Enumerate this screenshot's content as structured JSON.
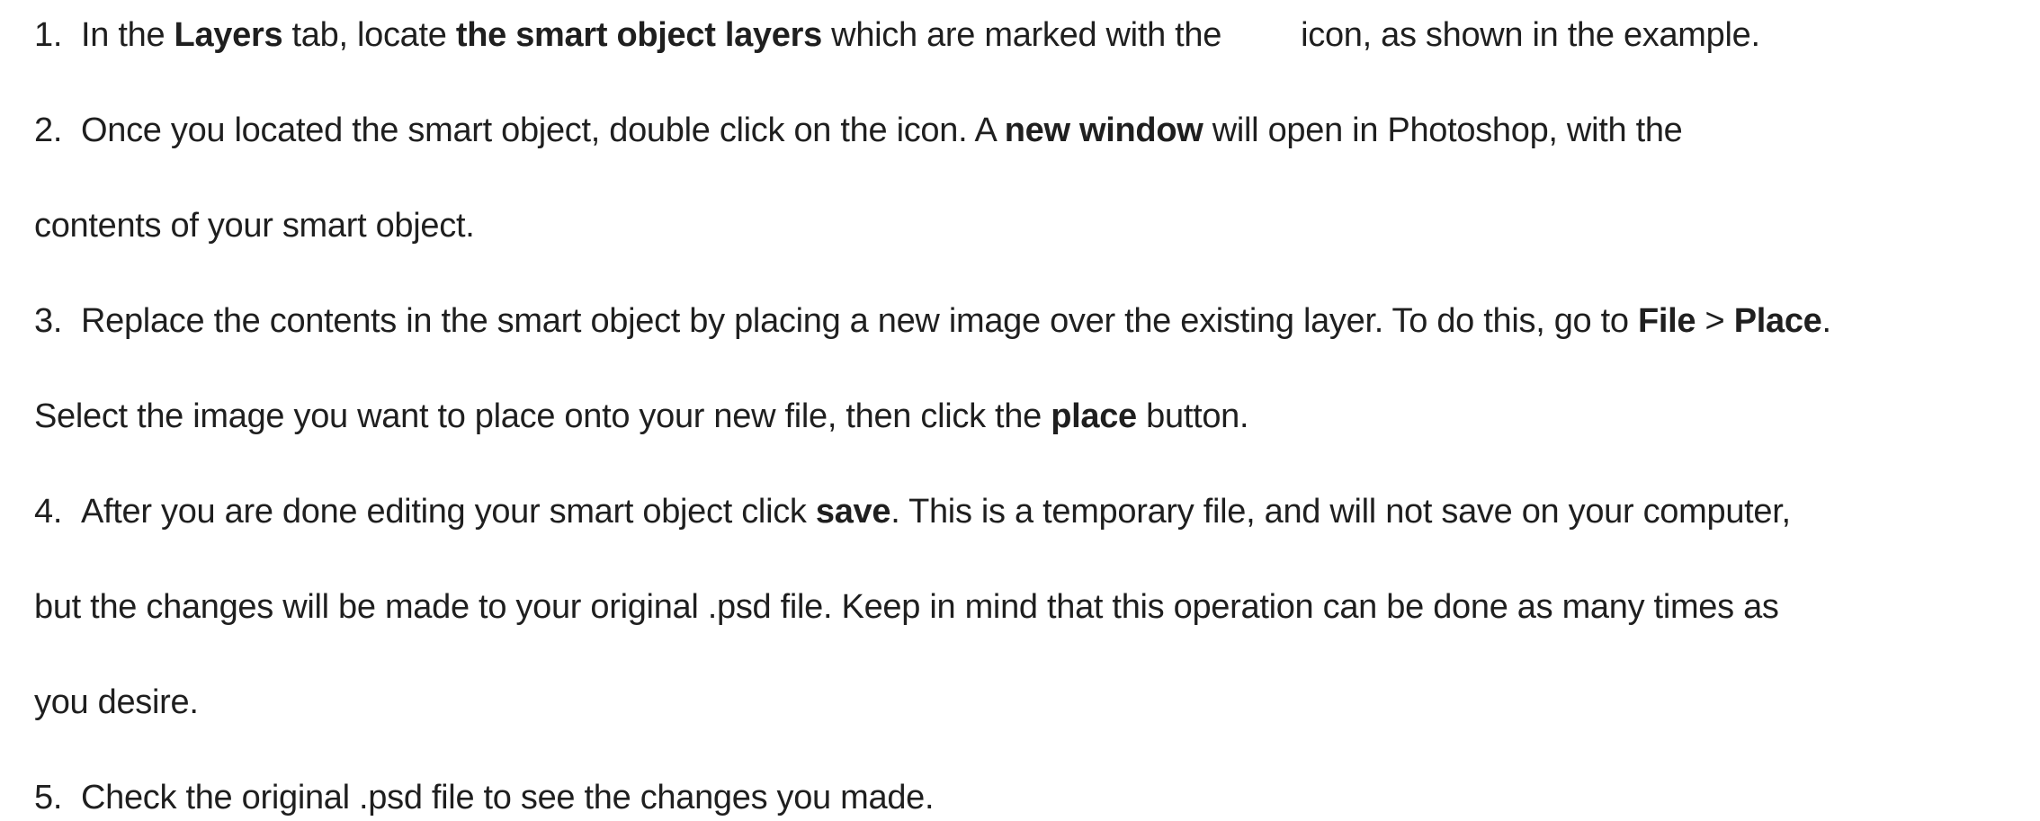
{
  "steps": [
    {
      "number": "1.",
      "lines": [
        [
          {
            "text": "In the ",
            "bold": false
          },
          {
            "text": "Layers",
            "bold": true
          },
          {
            "text": " tab, locate ",
            "bold": false
          },
          {
            "text": "the smart object layers",
            "bold": true
          },
          {
            "text": " which are marked with the",
            "bold": false
          },
          {
            "icon": "smart-object-icon"
          },
          {
            "text": "icon, as shown in the example.",
            "bold": false
          }
        ]
      ]
    },
    {
      "number": "2.",
      "lines": [
        [
          {
            "text": "Once you located the smart object, double click on the icon. A ",
            "bold": false
          },
          {
            "text": "new window",
            "bold": true
          },
          {
            "text": " will open in Photoshop, with the",
            "bold": false
          }
        ],
        [
          {
            "text": "contents of your smart object.",
            "bold": false
          }
        ]
      ]
    },
    {
      "number": "3.",
      "lines": [
        [
          {
            "text": "Replace the contents in the smart object by placing a new image over the existing layer. To do this, go to ",
            "bold": false
          },
          {
            "text": "File",
            "bold": true
          },
          {
            "text": " > ",
            "bold": false
          },
          {
            "text": "Place",
            "bold": true
          },
          {
            "text": ".",
            "bold": false
          }
        ],
        [
          {
            "text": "Select the image you want to place onto your new file, then click the ",
            "bold": false
          },
          {
            "text": "place",
            "bold": true
          },
          {
            "text": " button.",
            "bold": false
          }
        ]
      ]
    },
    {
      "number": "4.",
      "lines": [
        [
          {
            "text": "After you are done editing your smart object click ",
            "bold": false
          },
          {
            "text": "save",
            "bold": true
          },
          {
            "text": ". This is a temporary file, and will not save on your computer,",
            "bold": false
          }
        ],
        [
          {
            "text": "but the changes will be made to your original .psd file. Keep in mind that this operation can be done as many times as",
            "bold": false
          }
        ],
        [
          {
            "text": "you desire.",
            "bold": false
          }
        ]
      ]
    },
    {
      "number": "5.",
      "lines": [
        [
          {
            "text": "Check the original .psd file to see the changes you made.",
            "bold": false
          }
        ]
      ]
    }
  ]
}
